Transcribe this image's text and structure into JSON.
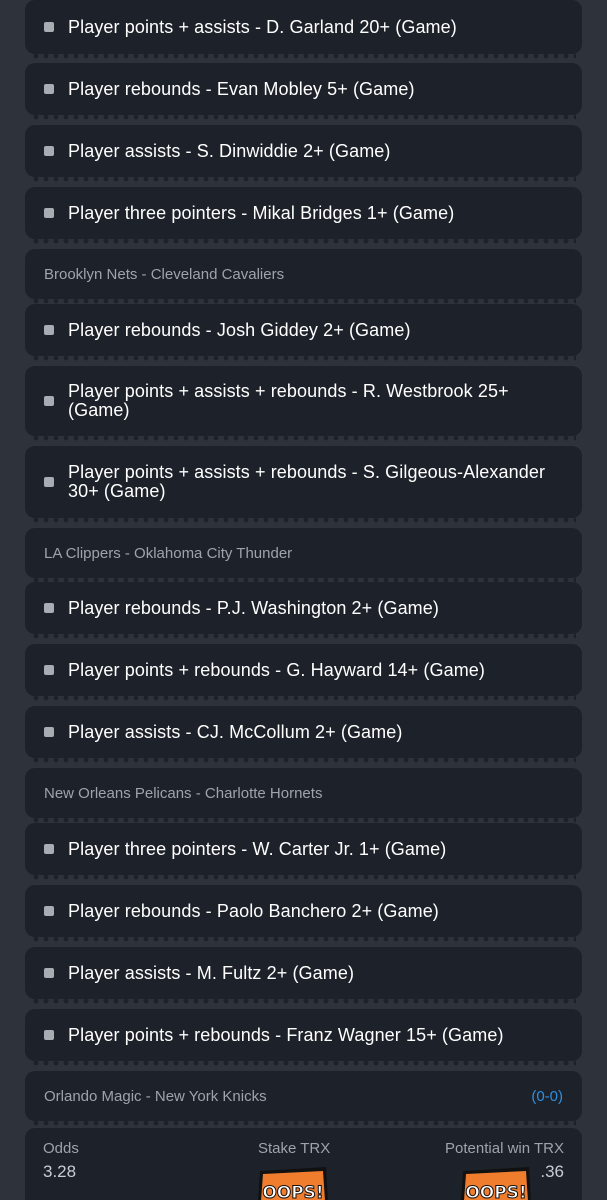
{
  "betslip": {
    "rows": [
      {
        "type": "selection",
        "text": "Player points + assists - D. Garland 20+ (Game)"
      },
      {
        "type": "selection",
        "text": "Player rebounds - Evan Mobley 5+ (Game)"
      },
      {
        "type": "selection",
        "text": "Player assists - S. Dinwiddie 2+ (Game)"
      },
      {
        "type": "selection",
        "text": "Player three pointers - Mikal Bridges 1+ (Game)"
      },
      {
        "type": "match",
        "text": "Brooklyn Nets - Cleveland Cavaliers"
      },
      {
        "type": "selection",
        "text": "Player rebounds - Josh Giddey 2+ (Game)"
      },
      {
        "type": "selection",
        "text": "Player points + assists + rebounds - R. Westbrook 25+ (Game)"
      },
      {
        "type": "selection",
        "text": "Player points + assists + rebounds - S. Gilgeous-Alexander 30+ (Game)"
      },
      {
        "type": "match",
        "text": "LA Clippers - Oklahoma City Thunder"
      },
      {
        "type": "selection",
        "text": "Player rebounds - P.J. Washington 2+ (Game)"
      },
      {
        "type": "selection",
        "text": "Player points + rebounds - G. Hayward 14+ (Game)"
      },
      {
        "type": "selection",
        "text": "Player assists - CJ. McCollum 2+ (Game)"
      },
      {
        "type": "match",
        "text": "New Orleans Pelicans - Charlotte Hornets"
      },
      {
        "type": "selection",
        "text": "Player three pointers - W. Carter Jr. 1+ (Game)"
      },
      {
        "type": "selection",
        "text": "Player rebounds - Paolo Banchero 2+ (Game)"
      },
      {
        "type": "selection",
        "text": "Player assists - M. Fultz 2+ (Game)"
      },
      {
        "type": "selection",
        "text": "Player points + rebounds - Franz Wagner 15+ (Game)"
      },
      {
        "type": "match",
        "text": "Orlando Magic - New York Knicks",
        "score": "(0-0)"
      }
    ]
  },
  "summary": {
    "odds_label": "Odds",
    "odds_value": "3.28",
    "stake_label": "Stake TRX",
    "potential_label": "Potential win TRX",
    "potential_value": ".36",
    "oops_label": "OOPS!"
  },
  "colors": {
    "background": "#2e333b",
    "card": "#1d2129",
    "score_accent": "#2f8fdf",
    "oops_fill": "#f07d2e"
  }
}
